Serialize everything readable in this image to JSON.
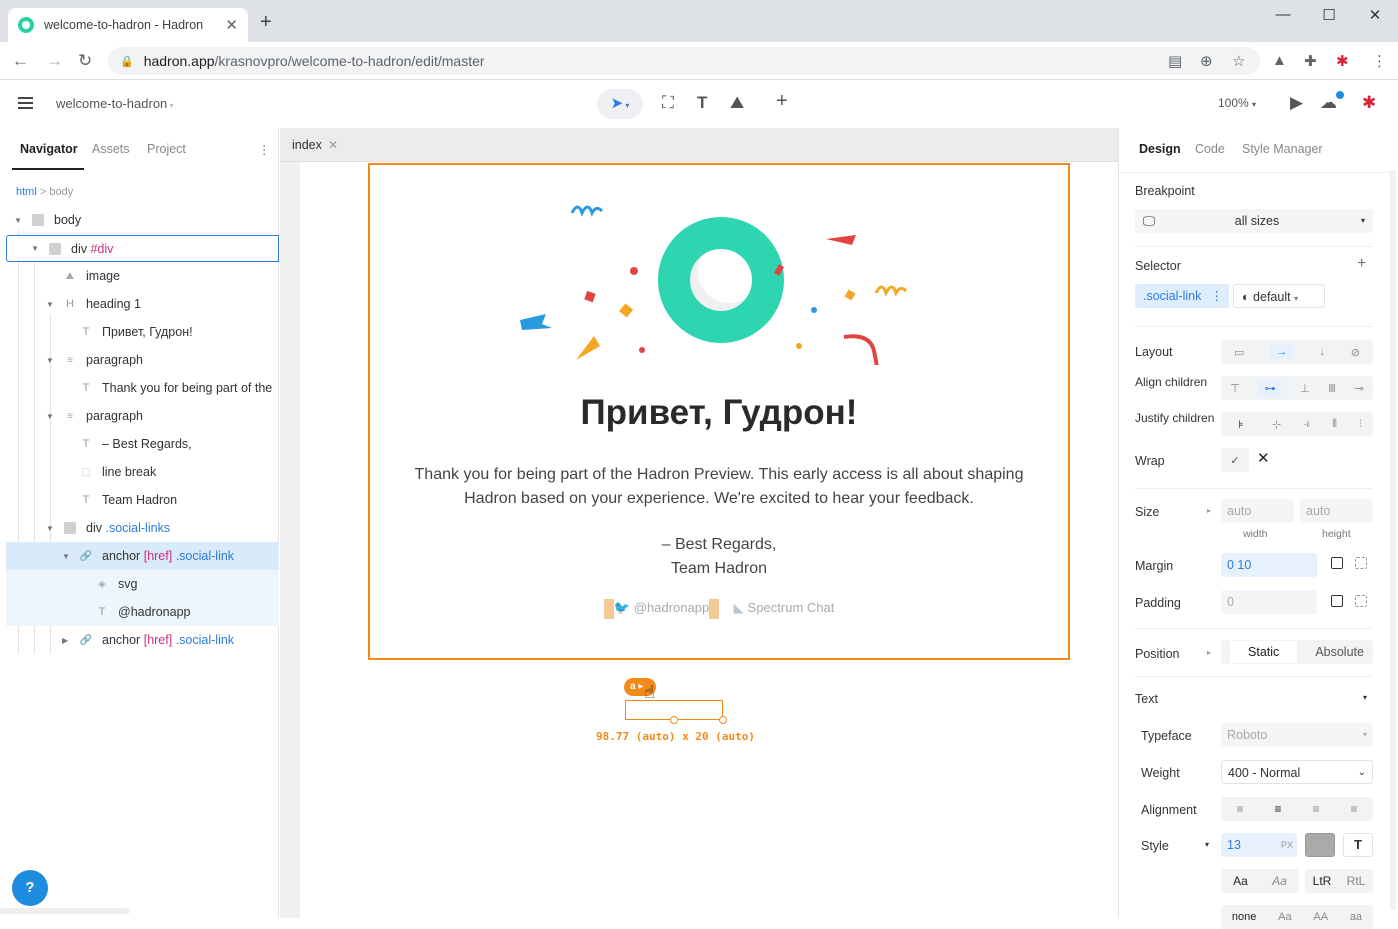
{
  "browser": {
    "tab_title": "welcome-to-hadron - Hadron",
    "url_host": "hadron.app",
    "url_path": "/krasnovpro/welcome-to-hadron/edit/master"
  },
  "app": {
    "project_name": "welcome-to-hadron",
    "zoom": "100%"
  },
  "left_panel": {
    "tabs": [
      "Navigator",
      "Assets",
      "Project"
    ],
    "breadcrumb": {
      "root": "html",
      "sep": ">",
      "current": "body"
    },
    "tree": [
      {
        "label": "body",
        "icon": "box-icon"
      },
      {
        "label": "div",
        "extra": "#div",
        "icon": "box-icon"
      },
      {
        "label": "image",
        "icon": "image-icon"
      },
      {
        "label": "heading 1",
        "icon": "heading-icon"
      },
      {
        "label": "Привет, Гудрон!",
        "icon": "text-icon"
      },
      {
        "label": "paragraph",
        "icon": "paragraph-icon"
      },
      {
        "label": "Thank you for being part of the",
        "icon": "text-icon"
      },
      {
        "label": "paragraph",
        "icon": "paragraph-icon"
      },
      {
        "label": "– Best Regards,",
        "icon": "text-icon"
      },
      {
        "label": "line break",
        "icon": "linebreak-icon"
      },
      {
        "label": "Team Hadron",
        "icon": "text-icon"
      },
      {
        "label": "div",
        "extra": ".social-links",
        "icon": "box-icon"
      },
      {
        "label": "anchor",
        "attr": "[href]",
        "extra": ".social-link",
        "icon": "link-icon"
      },
      {
        "label": "svg",
        "icon": "svg-icon"
      },
      {
        "label": "@hadronapp",
        "icon": "text-icon"
      },
      {
        "label": "anchor",
        "attr": "[href]",
        "extra": ".social-link",
        "icon": "link-icon"
      }
    ]
  },
  "canvas": {
    "doc_tab": "index",
    "heading": "Привет, Гудрон!",
    "paragraph": "Thank you for being part of the Hadron Preview. This early access is all about shaping Hadron based on your experience. We're excited to hear your feedback.",
    "regards_line1": "– Best Regards,",
    "regards_line2": "Team Hadron",
    "social_twitter": "@hadronapp",
    "social_spectrum": "Spectrum Chat",
    "selection_tag": "a",
    "selection_dims": "98.77 (auto) x 20 (auto)"
  },
  "right_panel": {
    "tabs": [
      "Design",
      "Code",
      "Style Manager"
    ],
    "breakpoint_label": "Breakpoint",
    "breakpoint_value": "all sizes",
    "selector_label": "Selector",
    "selector_class": ".social-link",
    "selector_state": "default",
    "layout_label": "Layout",
    "align_label": "Align children",
    "justify_label": "Justify children",
    "wrap_label": "Wrap",
    "size_label": "Size",
    "size_width": "auto",
    "size_height": "auto",
    "width_caption": "width",
    "height_caption": "height",
    "margin_label": "Margin",
    "margin_value": "0 10",
    "padding_label": "Padding",
    "padding_value": "0",
    "position_label": "Position",
    "position_options": [
      "Static",
      "Absolute"
    ],
    "text_label": "Text",
    "typeface_label": "Typeface",
    "typeface_value": "Roboto",
    "weight_label": "Weight",
    "weight_value": "400 - Normal",
    "alignment_label": "Alignment",
    "style_label": "Style",
    "font_size": "13",
    "font_unit": "PX",
    "case_options": [
      "Aa",
      "Aa"
    ],
    "dir_options": [
      "LtR",
      "RtL"
    ],
    "transform_options": [
      "none",
      "Aa",
      "AA",
      "aa"
    ]
  },
  "colors": {
    "accent": "#2d7be0",
    "selection": "#f28a1a",
    "logo": "#2dd6b0"
  }
}
